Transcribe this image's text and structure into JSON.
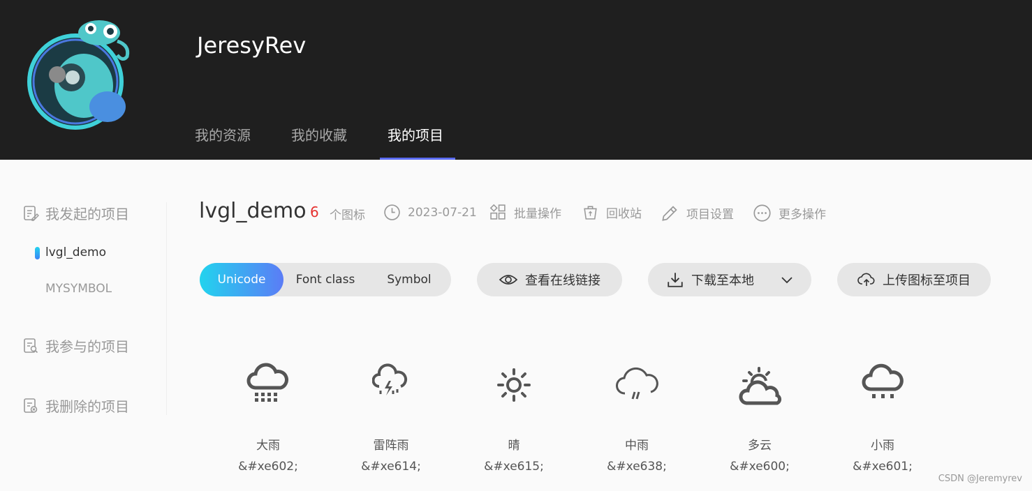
{
  "header": {
    "username": "JeresyRev",
    "tabs": [
      {
        "label": "我的资源"
      },
      {
        "label": "我的收藏"
      },
      {
        "label": "我的项目"
      }
    ]
  },
  "sidebar": {
    "group_started": "我发起的项目",
    "projects": [
      {
        "label": "lvgl_demo"
      },
      {
        "label": "MYSYMBOL"
      }
    ],
    "group_joined": "我参与的项目",
    "group_deleted": "我删除的项目"
  },
  "project": {
    "title": "lvgl_demo",
    "icon_count": "6",
    "icon_count_label": "个图标",
    "date": "2023-07-21",
    "batch_label": "批量操作",
    "recycle_label": "回收站",
    "settings_label": "项目设置",
    "more_label": "更多操作"
  },
  "toolbar": {
    "modes": [
      {
        "label": "Unicode"
      },
      {
        "label": "Font class"
      },
      {
        "label": "Symbol"
      }
    ],
    "view_link_label": "查看在线链接",
    "download_label": "下载至本地",
    "upload_label": "上传图标至项目"
  },
  "icons": [
    {
      "name": "大雨",
      "code": "&#xe602;",
      "icon": "heavy-rain-icon"
    },
    {
      "name": "雷阵雨",
      "code": "&#xe614;",
      "icon": "thunderstorm-icon"
    },
    {
      "name": "晴",
      "code": "&#xe615;",
      "icon": "sunny-icon"
    },
    {
      "name": "中雨",
      "code": "&#xe638;",
      "icon": "moderate-rain-icon"
    },
    {
      "name": "多云",
      "code": "&#xe600;",
      "icon": "cloudy-icon"
    },
    {
      "name": "小雨",
      "code": "&#xe601;",
      "icon": "light-rain-icon"
    }
  ],
  "watermark": "CSDN @Jeremyrev",
  "colors": {
    "header_bg": "#1f1f1f",
    "accent": "#5b6cf2",
    "count_red": "#e5312f"
  }
}
